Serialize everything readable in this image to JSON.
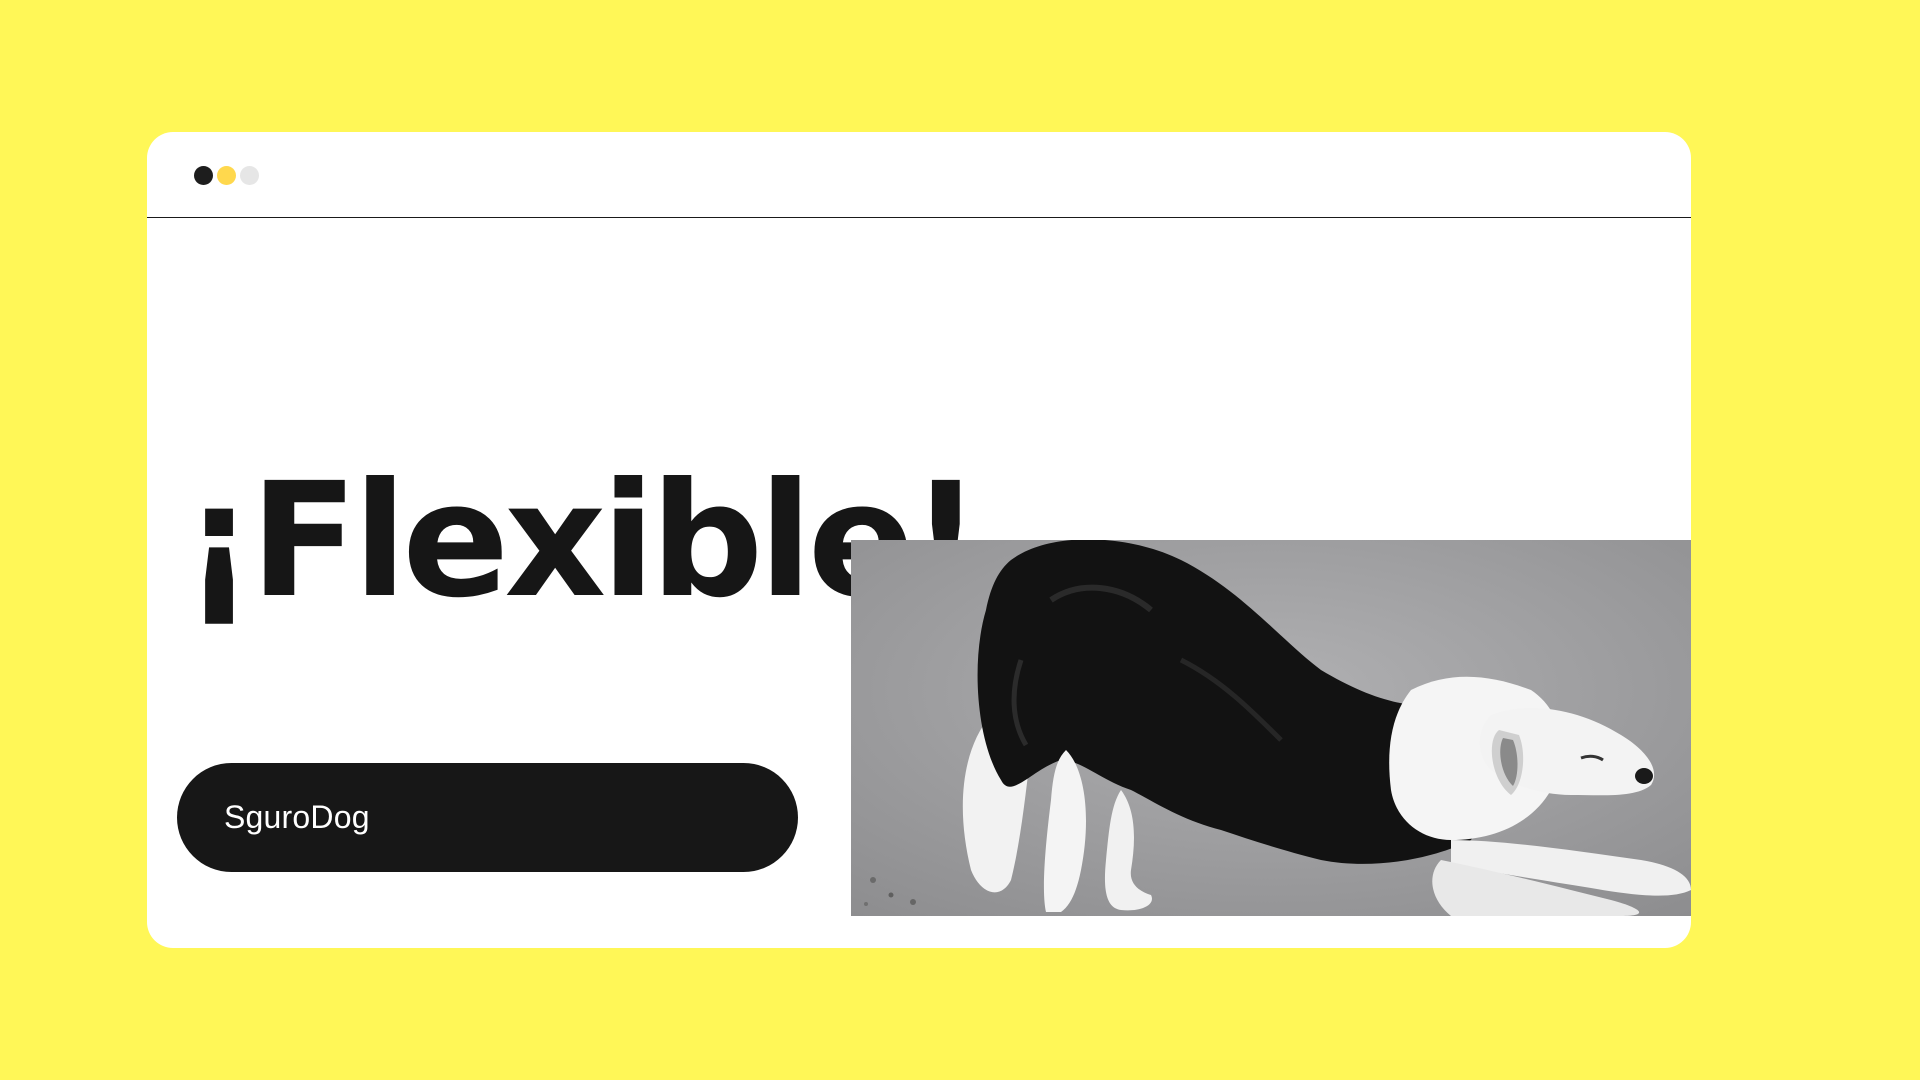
{
  "window": {
    "controls": [
      {
        "name": "dot-dark",
        "color": "#1d1d1d"
      },
      {
        "name": "dot-yellow",
        "color": "#FFD84D"
      },
      {
        "name": "dot-light",
        "color": "#E6E6E6"
      }
    ]
  },
  "headline": "¡Flexible!",
  "cta": {
    "label": "SguroDog"
  },
  "image": {
    "subject": "black-and-white dog stretching in a play bow on grey pavement"
  },
  "colors": {
    "background": "#FFF757",
    "card": "#FFFFFF",
    "text": "#161616",
    "pill": "#171717"
  }
}
